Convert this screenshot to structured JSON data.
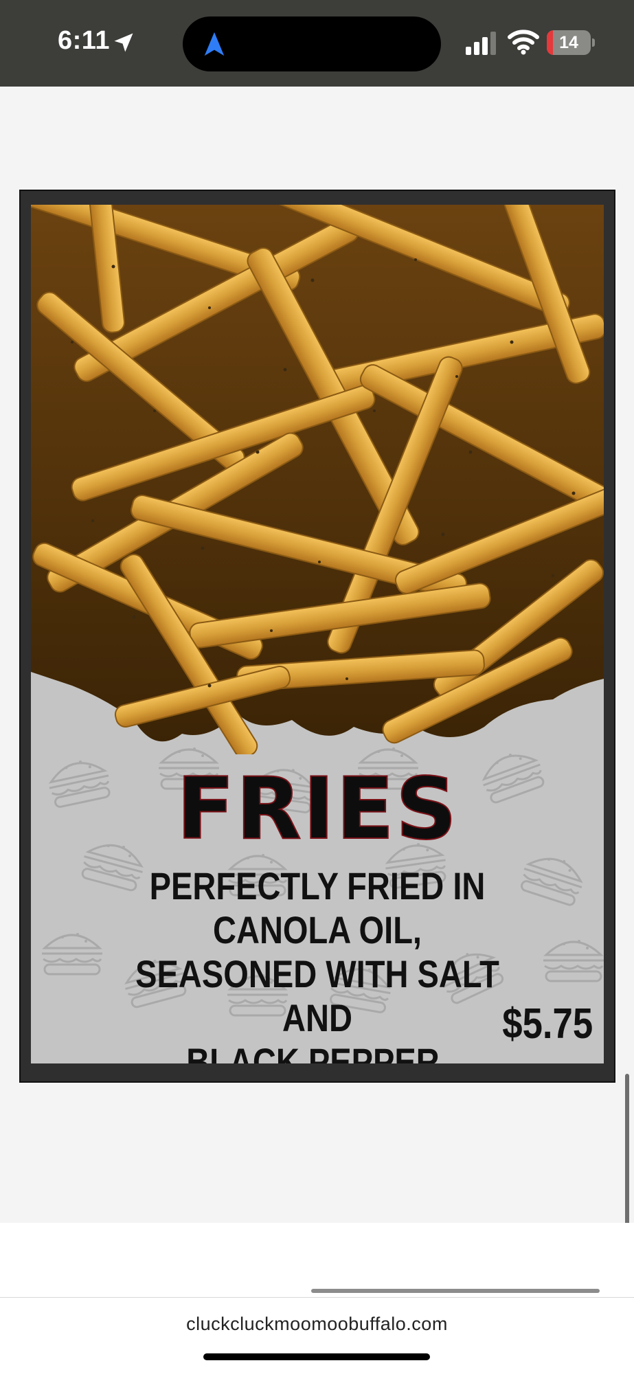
{
  "status_bar": {
    "time": "6:11",
    "battery_level": "14",
    "battery_fraction": 0.14,
    "signal_bars_active": 3,
    "signal_bars_total": 4,
    "icons": [
      "location-arrow-icon",
      "navigation-icon",
      "cellular-signal-icon",
      "wifi-icon",
      "battery-icon"
    ]
  },
  "menu_item": {
    "title": "FRIES",
    "description_lines": [
      "PERFECTLY FRIED IN CANOLA OIL,",
      "SEASONED WITH SALT AND",
      "BLACK PEPPER."
    ],
    "price": "$5.75",
    "image": "fries-photo"
  },
  "browser": {
    "url": "cluckcluckmoomoobuffalo.com"
  },
  "colors": {
    "status_bar_bg": "#3d3d3a",
    "card_border": "#2f2f2f",
    "card_bg": "#c4c4c4",
    "fries_gold": "#d9a13a",
    "battery_low": "#e5393b",
    "nav_blue": "#2f7df6",
    "title_outline": "#7a1218"
  }
}
